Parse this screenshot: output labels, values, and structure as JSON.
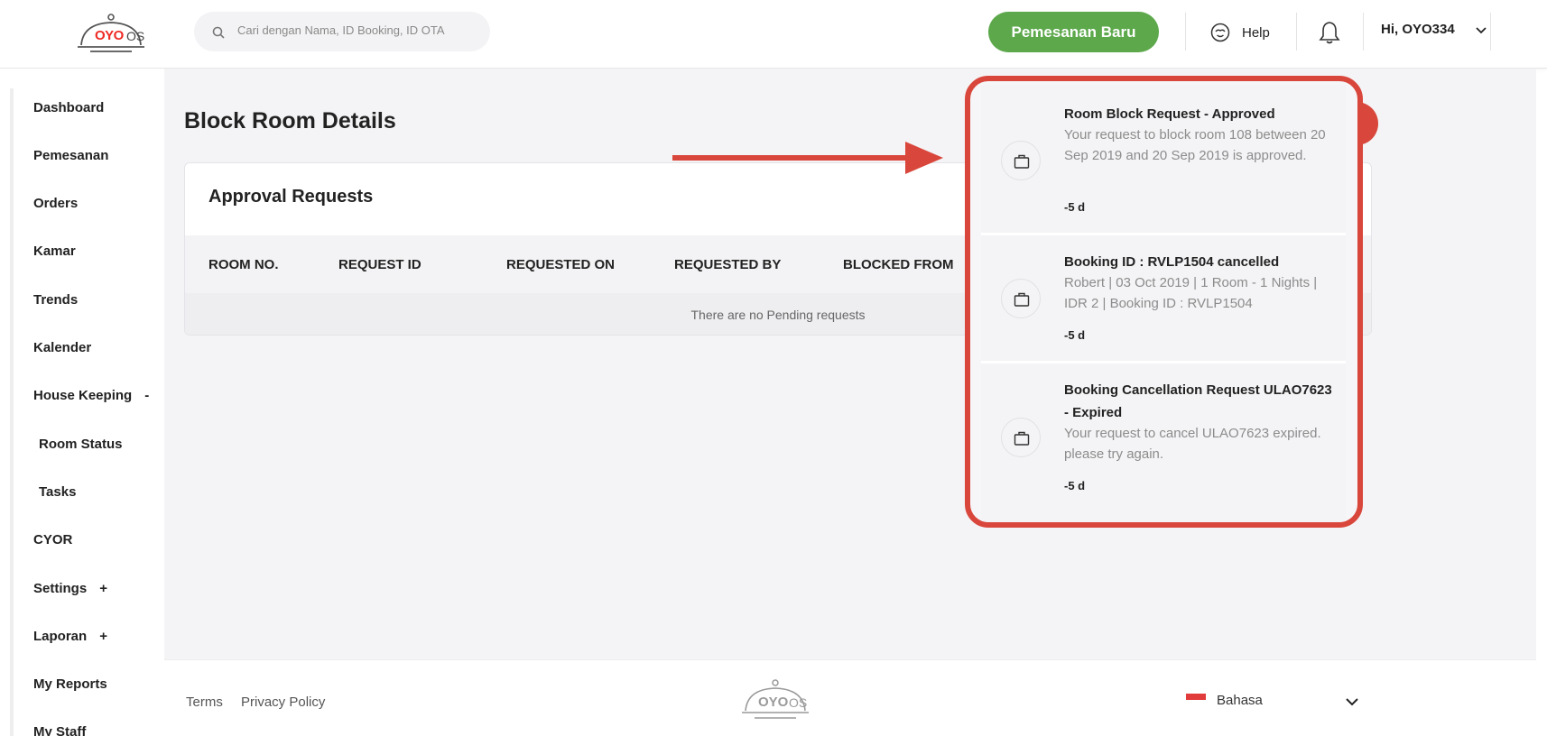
{
  "header": {
    "logo_text": "OYO",
    "logo_suffix": "OS",
    "search_placeholder": "Cari dengan Nama, ID Booking, ID OTA",
    "new_booking_label": "Pemesanan Baru",
    "help_label": "Help",
    "user_greeting": "Hi, OYO334"
  },
  "sidebar": {
    "items": [
      {
        "label": "Dashboard"
      },
      {
        "label": "Pemesanan"
      },
      {
        "label": "Orders"
      },
      {
        "label": "Kamar"
      },
      {
        "label": "Trends"
      },
      {
        "label": "Kalender"
      },
      {
        "label": "House Keeping",
        "toggle": "-"
      },
      {
        "label": "Room Status"
      },
      {
        "label": "Tasks"
      },
      {
        "label": "CYOR"
      },
      {
        "label": "Settings",
        "toggle": "+"
      },
      {
        "label": "Laporan",
        "toggle": "+"
      },
      {
        "label": "My Reports"
      },
      {
        "label": "My Staff"
      }
    ]
  },
  "main": {
    "page_title": "Block Room Details",
    "card_title": "Approval Requests",
    "columns": [
      "ROOM NO.",
      "REQUEST ID",
      "REQUESTED ON",
      "REQUESTED BY",
      "BLOCKED FROM"
    ],
    "empty_message": "There are no Pending requests"
  },
  "notifications": [
    {
      "title": "Room Block Request - Approved",
      "body": "Your request to block room 108 between 20 Sep 2019 and 20 Sep 2019 is approved.",
      "time": "-5 d"
    },
    {
      "title": "Booking ID : RVLP1504 cancelled",
      "body": "Robert | 03 Oct 2019 | 1 Room - 1 Nights | IDR 2 | Booking ID : RVLP1504",
      "time": "-5 d"
    },
    {
      "title": "Booking Cancellation Request ULAO7623 - Expired",
      "body": "Your request to cancel ULAO7623 expired. please try again.",
      "time": "-5 d"
    }
  ],
  "footer": {
    "terms_label": "Terms",
    "privacy_label": "Privacy Policy",
    "logo_text": "OYO",
    "logo_suffix": "OS",
    "language_label": "Bahasa"
  },
  "colors": {
    "brand_red": "#ee2a24",
    "primary_green": "#5ca84b",
    "annotation_red": "#d9463b"
  }
}
